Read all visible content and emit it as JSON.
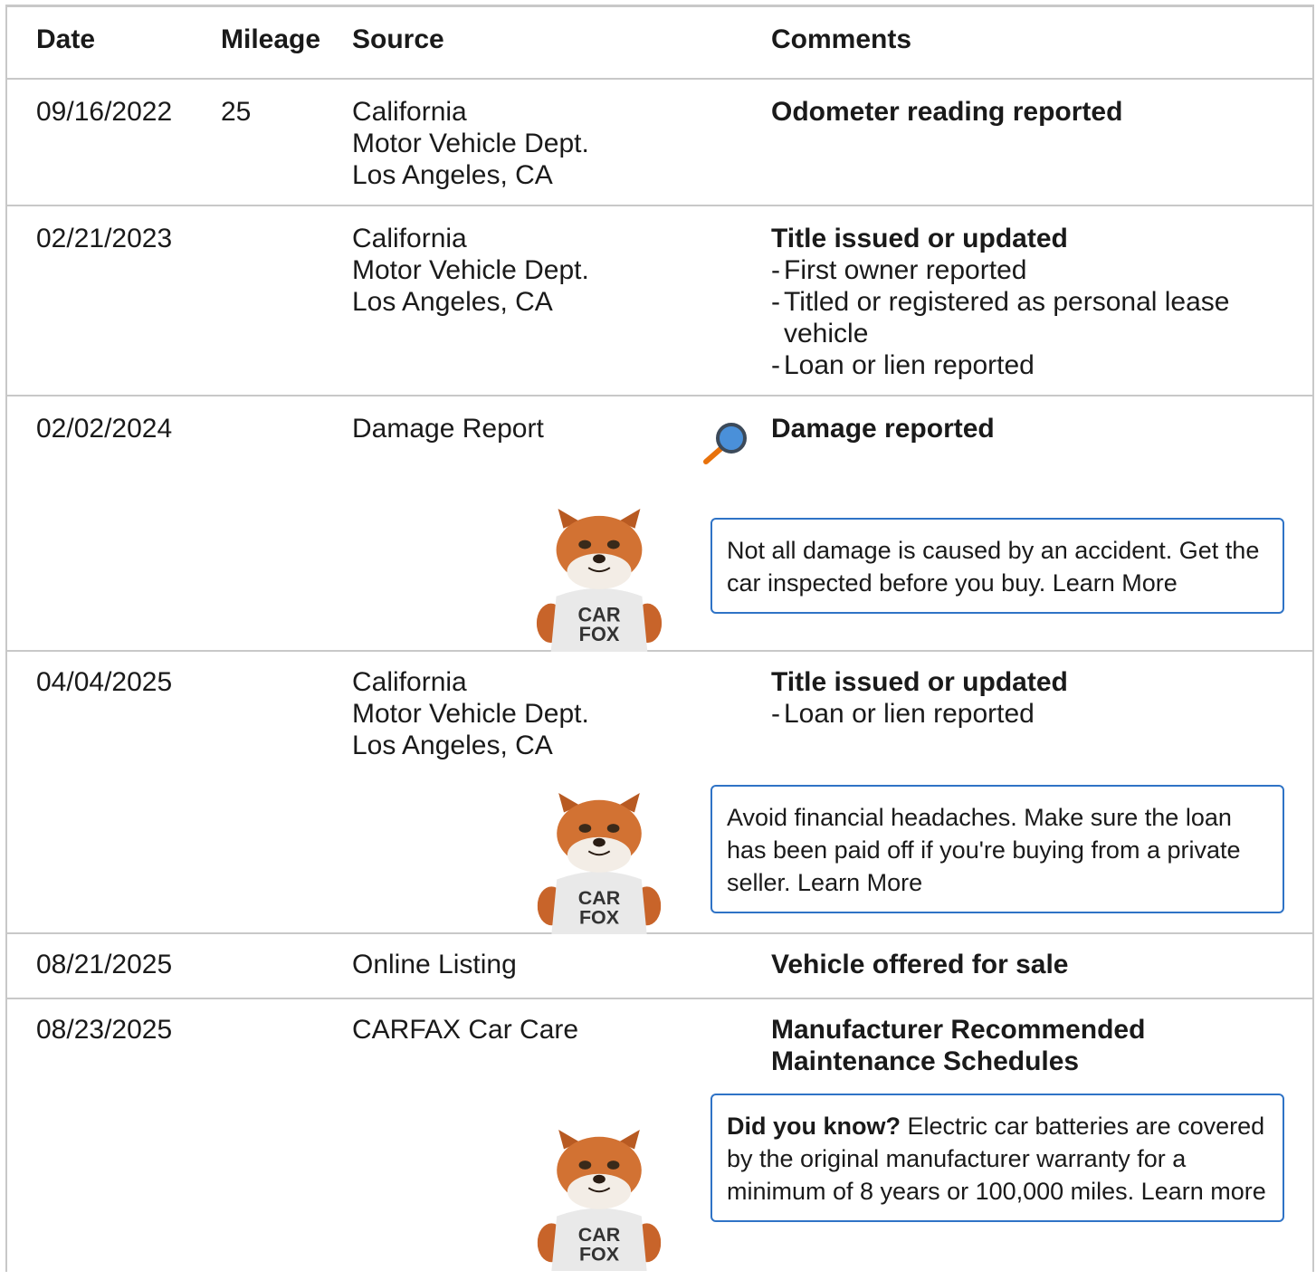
{
  "headers": {
    "date": "Date",
    "mileage": "Mileage",
    "source": "Source",
    "comments": "Comments"
  },
  "rows": [
    {
      "date": "09/16/2022",
      "mileage": "25",
      "source": [
        "California",
        "Motor Vehicle Dept.",
        "Los Angeles, CA"
      ],
      "comment_title": "Odometer reading reported"
    },
    {
      "date": "02/21/2023",
      "mileage": "",
      "source": [
        "California",
        "Motor Vehicle Dept.",
        "Los Angeles, CA"
      ],
      "comment_title": "Title issued or updated",
      "bullets": [
        "First owner reported",
        "Titled or registered as personal lease vehicle",
        "Loan or lien reported"
      ]
    },
    {
      "date": "02/02/2024",
      "mileage": "",
      "source": [
        "Damage Report"
      ],
      "comment_title": "Damage reported",
      "tip": "Not all damage is caused by an accident. Get the car inspected before you buy. Learn More"
    },
    {
      "date": "04/04/2025",
      "mileage": "",
      "source": [
        "California",
        "Motor Vehicle Dept.",
        "Los Angeles, CA"
      ],
      "comment_title": "Title issued or updated",
      "bullets": [
        "Loan or lien reported"
      ],
      "tip": "Avoid financial headaches. Make sure the loan has been paid off if you're buying from a private seller. Learn More"
    },
    {
      "date": "08/21/2025",
      "mileage": "",
      "source": [
        "Online Listing"
      ],
      "comment_title": "Vehicle offered for sale"
    },
    {
      "date": "08/23/2025",
      "mileage": "",
      "source": [
        "CARFAX Car Care"
      ],
      "comment_title": "Manufacturer Recommended Maintenance Schedules",
      "tip_bold": "Did you know?",
      "tip": " Electric car batteries are covered by the original manufacturer warranty for a minimum of 8 years or 100,000 miles. Learn more"
    }
  ],
  "mascot": {
    "shirt_line1": "CAR",
    "shirt_line2": "FOX"
  },
  "colors": {
    "tip_border": "#2f73c6",
    "divider": "#c8c8c8",
    "magnifier_lens": "#4a90d9",
    "magnifier_handle": "#e8720c"
  }
}
